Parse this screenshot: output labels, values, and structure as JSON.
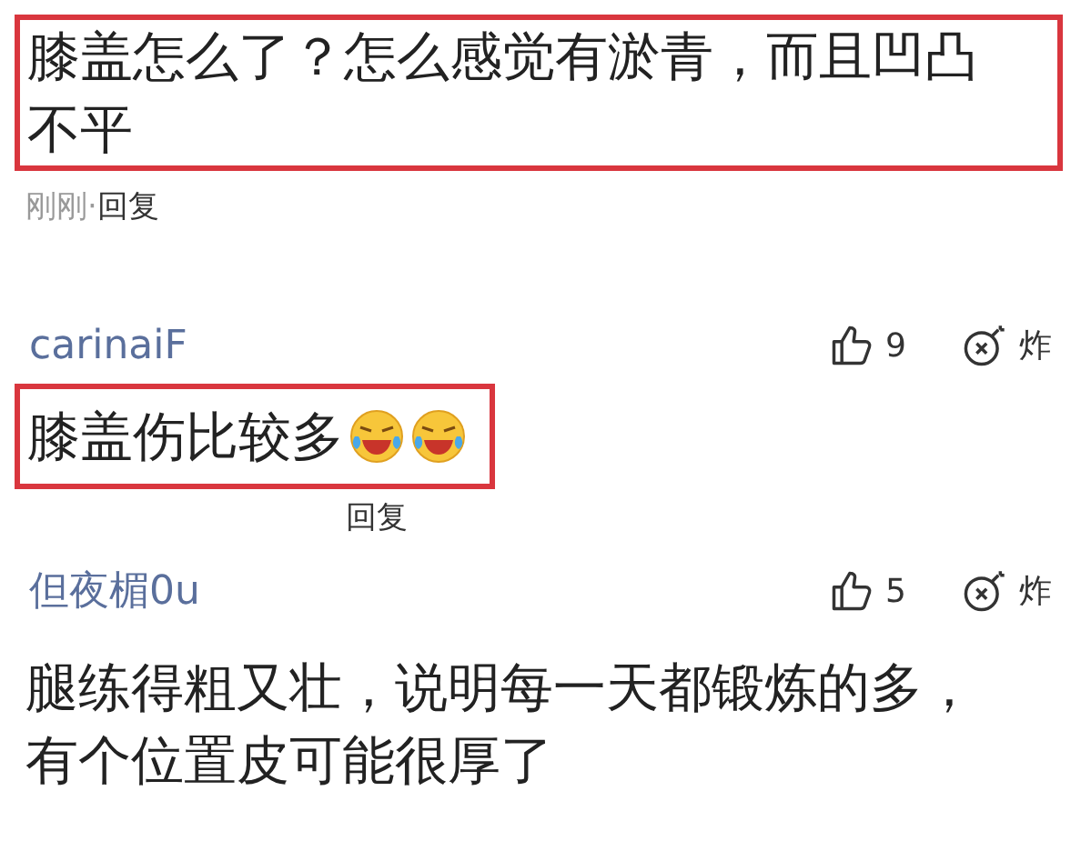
{
  "top_comment": {
    "text": "膝盖怎么了？怎么感觉有淤青，而且凹凸不平",
    "time": "刚刚",
    "separator": "·",
    "reply": "回复"
  },
  "comments": [
    {
      "user": "carinaiF",
      "likes": "9",
      "bomb": "炸",
      "text": "膝盖伤比较多",
      "emojis": [
        {
          "kind": "laugh-cry"
        },
        {
          "kind": "laugh-cry"
        }
      ],
      "highlighted": true,
      "reply": "回复"
    },
    {
      "user": "但夜楣0u",
      "likes": "5",
      "bomb": "炸",
      "text": "腿练得粗又壮，说明每一天都锻炼的多，有个位置皮可能很厚了",
      "highlighted": false
    }
  ]
}
